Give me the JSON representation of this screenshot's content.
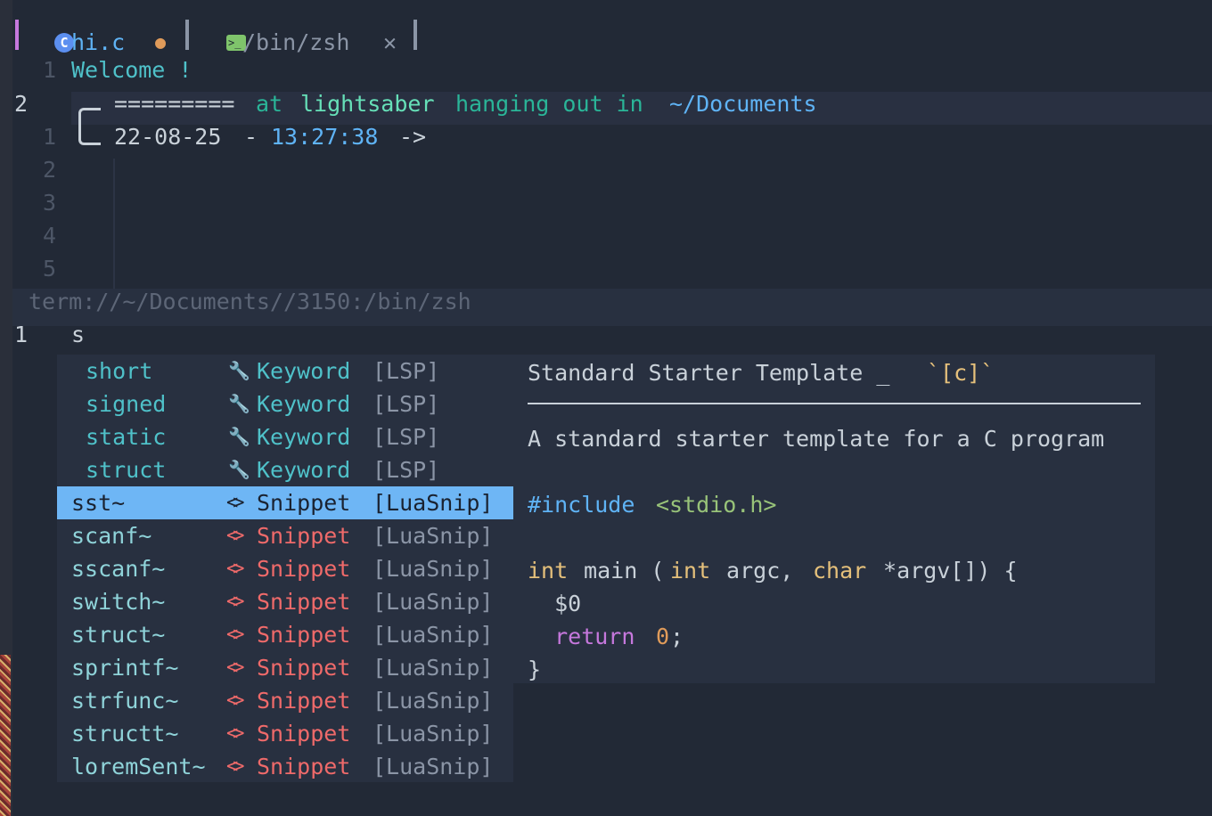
{
  "tabs": [
    {
      "icon": "c-file-icon",
      "label": "hi.c",
      "modified_dot": "●"
    },
    {
      "icon": "terminal-icon",
      "label": "/bin/zsh",
      "close": "✕"
    }
  ],
  "editor": {
    "lines": [
      {
        "num": "1",
        "text": "Welcome !"
      }
    ],
    "cursor_line_num": "2",
    "prompt": {
      "equals": "=========",
      "at": "at",
      "host": "lightsaber",
      "hanging": "hanging out in",
      "path": "~/Documents",
      "date": "22-08-25",
      "dash": "-",
      "time": "13:27:38",
      "arrow": "->"
    },
    "rel_nums": [
      "1",
      "2",
      "3",
      "4",
      "5"
    ]
  },
  "statusline": {
    "text": "term://~/Documents//3150:/bin/zsh"
  },
  "cmdline": {
    "num": "1",
    "text": "s"
  },
  "completion": {
    "items": [
      {
        "word": "short",
        "kind_icon": "wrench-icon",
        "kind": "Keyword",
        "source": "[LSP]",
        "selected": false,
        "indented": true
      },
      {
        "word": "signed",
        "kind_icon": "wrench-icon",
        "kind": "Keyword",
        "source": "[LSP]",
        "selected": false,
        "indented": true
      },
      {
        "word": "static",
        "kind_icon": "wrench-icon",
        "kind": "Keyword",
        "source": "[LSP]",
        "selected": false,
        "indented": true
      },
      {
        "word": "struct",
        "kind_icon": "wrench-icon",
        "kind": "Keyword",
        "source": "[LSP]",
        "selected": false,
        "indented": true
      },
      {
        "word": "sst~",
        "kind_icon": "snippet-icon",
        "kind": "Snippet",
        "source": "[LuaSnip]",
        "selected": true,
        "indented": false
      },
      {
        "word": "scanf~",
        "kind_icon": "snippet-icon",
        "kind": "Snippet",
        "source": "[LuaSnip]",
        "selected": false,
        "indented": false
      },
      {
        "word": "sscanf~",
        "kind_icon": "snippet-icon",
        "kind": "Snippet",
        "source": "[LuaSnip]",
        "selected": false,
        "indented": false
      },
      {
        "word": "switch~",
        "kind_icon": "snippet-icon",
        "kind": "Snippet",
        "source": "[LuaSnip]",
        "selected": false,
        "indented": false
      },
      {
        "word": "struct~",
        "kind_icon": "snippet-icon",
        "kind": "Snippet",
        "source": "[LuaSnip]",
        "selected": false,
        "indented": false
      },
      {
        "word": "sprintf~",
        "kind_icon": "snippet-icon",
        "kind": "Snippet",
        "source": "[LuaSnip]",
        "selected": false,
        "indented": false
      },
      {
        "word": "strfunc~",
        "kind_icon": "snippet-icon",
        "kind": "Snippet",
        "source": "[LuaSnip]",
        "selected": false,
        "indented": false
      },
      {
        "word": "structt~",
        "kind_icon": "snippet-icon",
        "kind": "Snippet",
        "source": "[LuaSnip]",
        "selected": false,
        "indented": false
      },
      {
        "word": "loremSent~",
        "kind_icon": "snippet-icon",
        "kind": "Snippet",
        "source": "[LuaSnip]",
        "selected": false,
        "indented": false
      }
    ]
  },
  "docs": {
    "title": "Standard Starter Template _",
    "lang_tag": "`[c]`",
    "description": "A standard starter template for a C program",
    "code": {
      "l1_directive": "#include",
      "l1_header": "<stdio.h>",
      "l2_int": "int",
      "l2_main": " main (",
      "l2_int2": "int",
      "l2_argc": " argc, ",
      "l2_char": "char",
      "l2_rest": " *argv[]) {",
      "l3_placeholder": "  $0",
      "l4_return": "  return",
      "l4_zero": "0",
      "l4_semi": ";",
      "l5_close": "}"
    }
  },
  "colors": {
    "accent": "#6eb6f5",
    "bg": "#222936",
    "keyword": "#c678dd",
    "snippet_kind": "#ef6a6a"
  }
}
